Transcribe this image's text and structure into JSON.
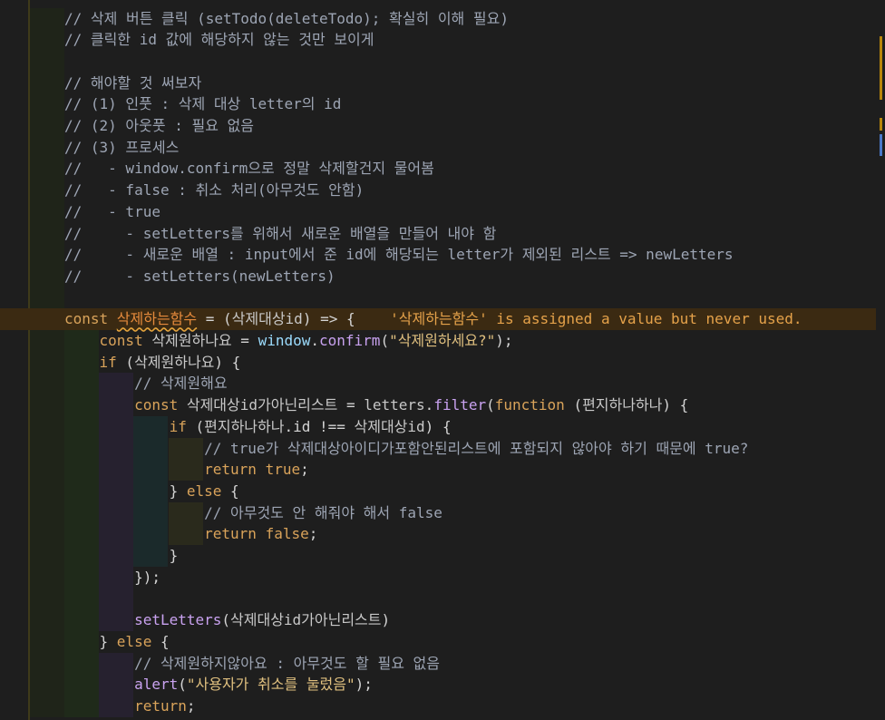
{
  "editor": {
    "lines": [
      {
        "text": "// 삭제 버튼 클릭 (setTodo(deleteTodo); 확실히 이해 필요)",
        "tokens": [
          {
            "t": "// 삭제 버튼 클릭 (setTodo(deleteTodo); 확실히 이해 필요)",
            "c": "comment"
          }
        ]
      },
      {
        "text": "// 클릭한 id 값에 해당하지 않는 것만 보이게",
        "tokens": [
          {
            "t": "// 클릭한 id 값에 해당하지 않는 것만 보이게",
            "c": "comment"
          }
        ]
      },
      {
        "text": "",
        "tokens": []
      },
      {
        "text": "// 해야할 것 써보자",
        "tokens": [
          {
            "t": "// 해야할 것 써보자",
            "c": "comment"
          }
        ]
      },
      {
        "text": "// (1) 인풋 : 삭제 대상 letter의 id",
        "tokens": [
          {
            "t": "// (1) 인풋 : 삭제 대상 letter의 id",
            "c": "comment"
          }
        ]
      },
      {
        "text": "// (2) 아웃풋 : 필요 없음",
        "tokens": [
          {
            "t": "// (2) 아웃풋 : 필요 없음",
            "c": "comment"
          }
        ]
      },
      {
        "text": "// (3) 프로세스",
        "tokens": [
          {
            "t": "// (3) 프로세스",
            "c": "comment"
          }
        ]
      },
      {
        "text": "//   - window.confirm으로 정말 삭제할건지 물어봄",
        "tokens": [
          {
            "t": "//   - window.confirm으로 정말 삭제할건지 물어봄",
            "c": "comment"
          }
        ]
      },
      {
        "text": "//   - false : 취소 처리(아무것도 안함)",
        "tokens": [
          {
            "t": "//   - false : 취소 처리(아무것도 안함)",
            "c": "comment"
          }
        ]
      },
      {
        "text": "//   - true",
        "tokens": [
          {
            "t": "//   - true",
            "c": "comment"
          }
        ]
      },
      {
        "text": "//     - setLetters를 위해서 새로운 배열을 만들어 내야 함",
        "tokens": [
          {
            "t": "//     - setLetters를 위해서 새로운 배열을 만들어 내야 함",
            "c": "comment"
          }
        ]
      },
      {
        "text": "//     - 새로운 배열 : input에서 준 id에 해당되는 letter가 제외된 리스트 => newLetters",
        "tokens": [
          {
            "t": "//     - 새로운 배열 : input에서 준 id에 해당되는 letter가 제외된 리스트 => newLetters",
            "c": "comment"
          }
        ]
      },
      {
        "text": "//     - setLetters(newLetters)",
        "tokens": [
          {
            "t": "//     - setLetters(newLetters)",
            "c": "comment"
          }
        ]
      },
      {
        "text": "",
        "tokens": []
      },
      {
        "text": "const 삭제하는함수 = (삭제대상id) => {    '삭제하는함수' is assigned a value but never used.",
        "highlight": true,
        "tokens": [
          {
            "t": "const ",
            "c": "kw"
          },
          {
            "t": "삭제하는함수",
            "c": "warnvar"
          },
          {
            "t": " = (",
            "c": "punc"
          },
          {
            "t": "삭제대상id",
            "c": "var"
          },
          {
            "t": ") => {",
            "c": "punc"
          },
          {
            "t": "    '삭제하는함수' is assigned a value but never used.",
            "c": "diag"
          }
        ]
      },
      {
        "text": "    const 삭제원하나요 = window.confirm(\"삭제원하세요?\");",
        "indent": 1,
        "tokens": [
          {
            "t": "    ",
            "c": "punc"
          },
          {
            "t": "const ",
            "c": "kw"
          },
          {
            "t": "삭제원하나요",
            "c": "var"
          },
          {
            "t": " = ",
            "c": "punc"
          },
          {
            "t": "window",
            "c": "prop"
          },
          {
            "t": ".",
            "c": "punc"
          },
          {
            "t": "confirm",
            "c": "fn"
          },
          {
            "t": "(",
            "c": "punc"
          },
          {
            "t": "\"삭제원하세요?\"",
            "c": "str"
          },
          {
            "t": ");",
            "c": "punc"
          }
        ]
      },
      {
        "text": "    if (삭제원하나요) {",
        "indent": 1,
        "tokens": [
          {
            "t": "    ",
            "c": "punc"
          },
          {
            "t": "if",
            "c": "kw"
          },
          {
            "t": " (",
            "c": "punc"
          },
          {
            "t": "삭제원하나요",
            "c": "var"
          },
          {
            "t": ") {",
            "c": "punc"
          }
        ]
      },
      {
        "text": "        // 삭제원해요",
        "indent": 2,
        "tokens": [
          {
            "t": "        ",
            "c": "punc"
          },
          {
            "t": "// 삭제원해요",
            "c": "comment"
          }
        ]
      },
      {
        "text": "        const 삭제대상id가아닌리스트 = letters.filter(function (편지하나하나) {",
        "indent": 2,
        "tokens": [
          {
            "t": "        ",
            "c": "punc"
          },
          {
            "t": "const ",
            "c": "kw"
          },
          {
            "t": "삭제대상id가아닌리스트",
            "c": "var"
          },
          {
            "t": " = ",
            "c": "punc"
          },
          {
            "t": "letters",
            "c": "var"
          },
          {
            "t": ".",
            "c": "punc"
          },
          {
            "t": "filter",
            "c": "fn"
          },
          {
            "t": "(",
            "c": "punc"
          },
          {
            "t": "function",
            "c": "kw"
          },
          {
            "t": " (",
            "c": "punc"
          },
          {
            "t": "편지하나하나",
            "c": "var"
          },
          {
            "t": ") {",
            "c": "punc"
          }
        ]
      },
      {
        "text": "            if (편지하나하나.id !== 삭제대상id) {",
        "indent": 3,
        "tokens": [
          {
            "t": "            ",
            "c": "punc"
          },
          {
            "t": "if",
            "c": "kw"
          },
          {
            "t": " (",
            "c": "punc"
          },
          {
            "t": "편지하나하나",
            "c": "var"
          },
          {
            "t": ".id !== ",
            "c": "punc"
          },
          {
            "t": "삭제대상id",
            "c": "var"
          },
          {
            "t": ") {",
            "c": "punc"
          }
        ]
      },
      {
        "text": "                // true가 삭제대상아이디가포함안된리스트에 포함되지 않아야 하기 때문에 true?",
        "indent": 4,
        "tokens": [
          {
            "t": "                ",
            "c": "punc"
          },
          {
            "t": "// true가 삭제대상아이디가포함안된리스트에 포함되지 않아야 하기 때문에 true?",
            "c": "comment"
          }
        ]
      },
      {
        "text": "                return true;",
        "indent": 4,
        "tokens": [
          {
            "t": "                ",
            "c": "punc"
          },
          {
            "t": "return",
            "c": "kw"
          },
          {
            "t": " ",
            "c": "punc"
          },
          {
            "t": "true",
            "c": "kw"
          },
          {
            "t": ";",
            "c": "punc"
          }
        ]
      },
      {
        "text": "            } else {",
        "indent": 3,
        "tokens": [
          {
            "t": "            } ",
            "c": "punc"
          },
          {
            "t": "else",
            "c": "kw"
          },
          {
            "t": " {",
            "c": "punc"
          }
        ]
      },
      {
        "text": "                // 아무것도 안 해줘야 해서 false",
        "indent": 4,
        "tokens": [
          {
            "t": "                ",
            "c": "punc"
          },
          {
            "t": "// 아무것도 안 해줘야 해서 false",
            "c": "comment"
          }
        ]
      },
      {
        "text": "                return false;",
        "indent": 4,
        "tokens": [
          {
            "t": "                ",
            "c": "punc"
          },
          {
            "t": "return",
            "c": "kw"
          },
          {
            "t": " ",
            "c": "punc"
          },
          {
            "t": "false",
            "c": "kw"
          },
          {
            "t": ";",
            "c": "punc"
          }
        ]
      },
      {
        "text": "            }",
        "indent": 3,
        "tokens": [
          {
            "t": "            }",
            "c": "punc"
          }
        ]
      },
      {
        "text": "        });",
        "indent": 2,
        "tokens": [
          {
            "t": "        });",
            "c": "punc"
          }
        ]
      },
      {
        "text": "",
        "indent": 2,
        "tokens": []
      },
      {
        "text": "        setLetters(삭제대상id가아닌리스트)",
        "indent": 2,
        "tokens": [
          {
            "t": "        ",
            "c": "punc"
          },
          {
            "t": "setLetters",
            "c": "fn"
          },
          {
            "t": "(",
            "c": "punc"
          },
          {
            "t": "삭제대상id가아닌리스트",
            "c": "var"
          },
          {
            "t": ")",
            "c": "punc"
          }
        ]
      },
      {
        "text": "    } else {",
        "indent": 1,
        "tokens": [
          {
            "t": "    } ",
            "c": "punc"
          },
          {
            "t": "else",
            "c": "kw"
          },
          {
            "t": " {",
            "c": "punc"
          }
        ]
      },
      {
        "text": "        // 삭제원하지않아요 : 아무것도 할 필요 없음",
        "indent": 2,
        "tokens": [
          {
            "t": "        ",
            "c": "punc"
          },
          {
            "t": "// 삭제원하지않아요 : 아무것도 할 필요 없음",
            "c": "comment"
          }
        ]
      },
      {
        "text": "        alert(\"사용자가 취소를 눌렀음\");",
        "indent": 2,
        "tokens": [
          {
            "t": "        ",
            "c": "punc"
          },
          {
            "t": "alert",
            "c": "fn"
          },
          {
            "t": "(",
            "c": "punc"
          },
          {
            "t": "\"사용자가 취소를 눌렀음\"",
            "c": "str"
          },
          {
            "t": ");",
            "c": "punc"
          }
        ]
      },
      {
        "text": "        return;",
        "indent": 2,
        "tokens": [
          {
            "t": "        ",
            "c": "punc"
          },
          {
            "t": "return",
            "c": "kw"
          },
          {
            "t": ";",
            "c": "punc"
          }
        ]
      }
    ]
  },
  "colors": {
    "background": "#1e1e1e",
    "comment": "#9da5b4",
    "keyword": "#d9a35a",
    "string": "#e0c07f",
    "function": "#c9a2f0",
    "warning": "#e5a24a",
    "highlight_line": "#3b2a12"
  }
}
